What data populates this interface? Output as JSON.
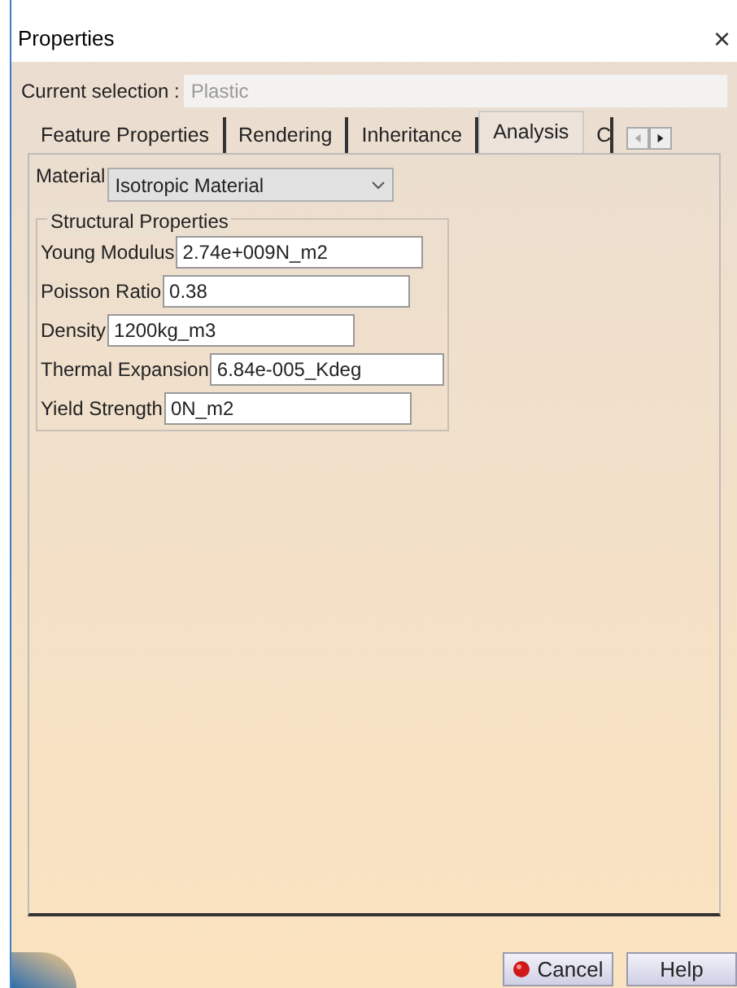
{
  "window": {
    "title": "Properties",
    "close": "×"
  },
  "current_selection": {
    "label": "Current selection :",
    "value": "Plastic"
  },
  "tabs": [
    {
      "label": "Feature Properties",
      "selected": false
    },
    {
      "label": "Rendering",
      "selected": false
    },
    {
      "label": "Inheritance",
      "selected": false
    },
    {
      "label": "Analysis",
      "selected": true
    },
    {
      "label": "C",
      "selected": false
    }
  ],
  "material": {
    "label": "Material",
    "value": "Isotropic Material"
  },
  "group": {
    "title": "Structural Properties",
    "fields": [
      {
        "label": "Young Modulus",
        "value": "2.74e+009N_m2"
      },
      {
        "label": "Poisson Ratio",
        "value": "0.38"
      },
      {
        "label": "Density",
        "value": "1200kg_m3"
      },
      {
        "label": "Thermal Expansion",
        "value": "6.84e-005_Kdeg"
      },
      {
        "label": "Yield Strength",
        "value": "0N_m2"
      }
    ]
  },
  "buttons": [
    {
      "label": "Cancel",
      "kind": "cancel"
    },
    {
      "label": "Help",
      "kind": "plain"
    }
  ]
}
